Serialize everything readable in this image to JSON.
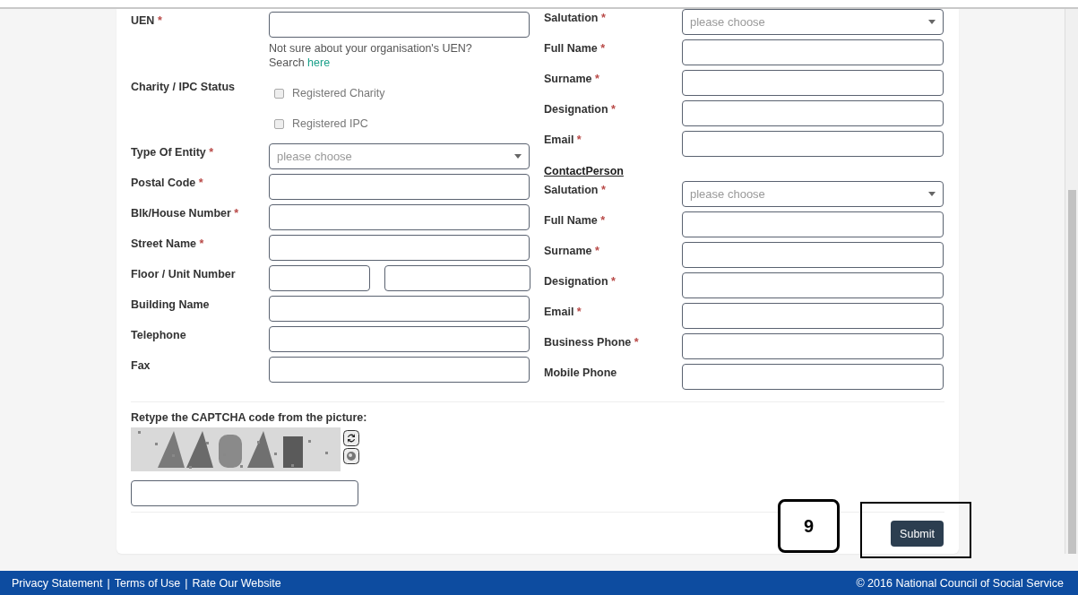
{
  "required_mark": "*",
  "left_fields": [
    {
      "kind": "text",
      "label": "UEN",
      "required": true,
      "help": "Not sure about your organisation's UEN?",
      "help_prefix": "Search",
      "help_link": "here"
    },
    {
      "kind": "checkboxes",
      "label": "Charity / IPC Status",
      "required": false,
      "options": [
        {
          "label": "Registered Charity",
          "checked": false
        },
        {
          "label": "Registered IPC",
          "checked": false
        }
      ]
    },
    {
      "kind": "select",
      "label": "Type Of Entity",
      "required": true,
      "placeholder": "please choose"
    },
    {
      "kind": "text",
      "label": "Postal Code",
      "required": true
    },
    {
      "kind": "text",
      "label": "Blk/House Number",
      "required": true
    },
    {
      "kind": "text",
      "label": "Street Name",
      "required": true
    },
    {
      "kind": "split",
      "label": "Floor / Unit Number",
      "required": false
    },
    {
      "kind": "text",
      "label": "Building Name",
      "required": false
    },
    {
      "kind": "text",
      "label": "Telephone",
      "required": false
    },
    {
      "kind": "text",
      "label": "Fax",
      "required": false
    }
  ],
  "right_sections": [
    {
      "fields": [
        {
          "kind": "select",
          "label": "Salutation",
          "required": true,
          "placeholder": "please choose"
        },
        {
          "kind": "text",
          "label": "Full Name",
          "required": true
        },
        {
          "kind": "text",
          "label": "Surname",
          "required": true
        },
        {
          "kind": "text",
          "label": "Designation",
          "required": true
        },
        {
          "kind": "text",
          "label": "Email",
          "required": true
        }
      ]
    },
    {
      "heading": "ContactPerson",
      "fields": [
        {
          "kind": "select",
          "label": "Salutation",
          "required": true,
          "placeholder": "please choose"
        },
        {
          "kind": "text",
          "label": "Full Name",
          "required": true
        },
        {
          "kind": "text",
          "label": "Surname",
          "required": true
        },
        {
          "kind": "text",
          "label": "Designation",
          "required": true
        },
        {
          "kind": "text",
          "label": "Email",
          "required": true
        },
        {
          "kind": "text",
          "label": "Business Phone",
          "required": true
        },
        {
          "kind": "text",
          "label": "Mobile Phone",
          "required": false
        }
      ]
    }
  ],
  "captcha": {
    "label": "Retype the CAPTCHA code from the picture:"
  },
  "submit": "Submit",
  "annotation": {
    "label": "9"
  },
  "footer": {
    "links": [
      "Privacy Statement",
      "Terms of Use",
      "Rate Our Website"
    ],
    "separator": "|",
    "copyright": "© 2016 National Council of Social Service"
  }
}
